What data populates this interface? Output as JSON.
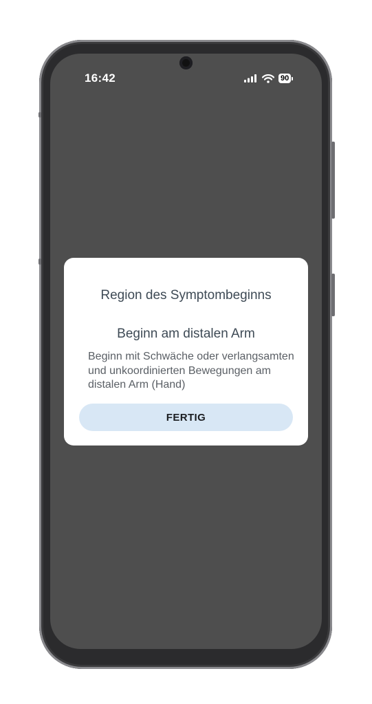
{
  "status_bar": {
    "time": "16:42",
    "battery": "90"
  },
  "dialog": {
    "title": "Region des Symptombeginns",
    "option_title": "Beginn am distalen Arm",
    "option_description": "Beginn mit Schwäche oder verlangsamten und unkoordinierten Bewegungen am distalen Arm (Hand)",
    "done_label": "FERTIG"
  },
  "colors": {
    "scrim": "#4e4e4e",
    "button_bg": "#d8e7f5",
    "title_text": "#3e4a55"
  }
}
